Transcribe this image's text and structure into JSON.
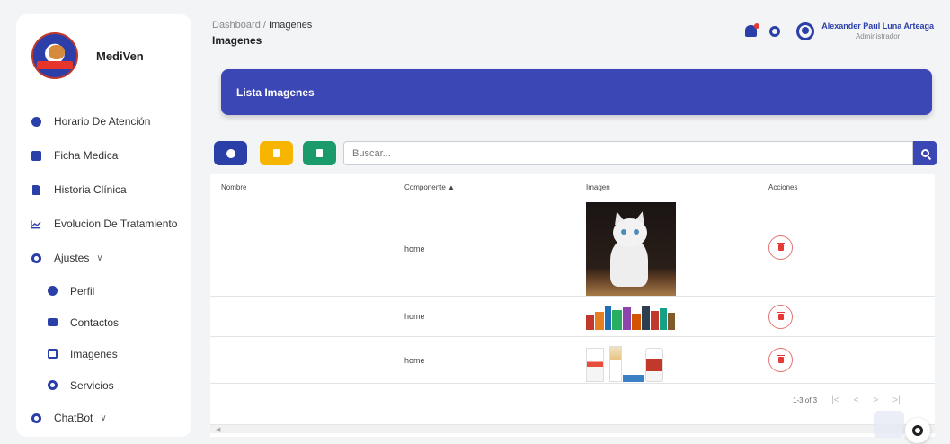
{
  "app": {
    "name": "MediVen"
  },
  "header": {
    "breadcrumb_root": "Dashboard",
    "breadcrumb_sep": " / ",
    "breadcrumb_current": "Imagenes",
    "title": "Imagenes",
    "user_name": "Alexander Paul Luna Arteaga",
    "user_role": "Administrador"
  },
  "sidebar": {
    "items": [
      {
        "label": "Horario De Atención",
        "icon": "clock-icon"
      },
      {
        "label": "Ficha Medica",
        "icon": "medical-plus-icon"
      },
      {
        "label": "Historia Clínica",
        "icon": "file-medical-icon"
      },
      {
        "label": "Evolucion De Tratamiento",
        "icon": "chart-line-icon"
      },
      {
        "label": "Ajustes",
        "icon": "gear-icon",
        "expanded": true
      },
      {
        "label": "Perfil",
        "icon": "user-circle-icon",
        "sub": true
      },
      {
        "label": "Contactos",
        "icon": "book-icon",
        "sub": true
      },
      {
        "label": "Imagenes",
        "icon": "images-icon",
        "sub": true
      },
      {
        "label": "Servicios",
        "icon": "gear-icon",
        "sub": true
      },
      {
        "label": "ChatBot",
        "icon": "gear-icon",
        "expanded": false
      }
    ]
  },
  "banner": {
    "title": "Lista Imagenes"
  },
  "search": {
    "placeholder": "Buscar..."
  },
  "table": {
    "columns": [
      "Nombre",
      "Componente ▲",
      "Imagen",
      "Acciones"
    ],
    "rows": [
      {
        "nombre": "",
        "componente": "home",
        "imagen": "kitten-photo"
      },
      {
        "nombre": "",
        "componente": "home",
        "imagen": "pet-food-products"
      },
      {
        "nombre": "",
        "componente": "home",
        "imagen": "pet-medicine-products"
      }
    ]
  },
  "pagination": {
    "range": "1-3 of 3"
  },
  "colors": {
    "primary": "#3b47b5",
    "warning": "#f7b500",
    "success": "#1b9a6b",
    "danger": "#e53935"
  }
}
